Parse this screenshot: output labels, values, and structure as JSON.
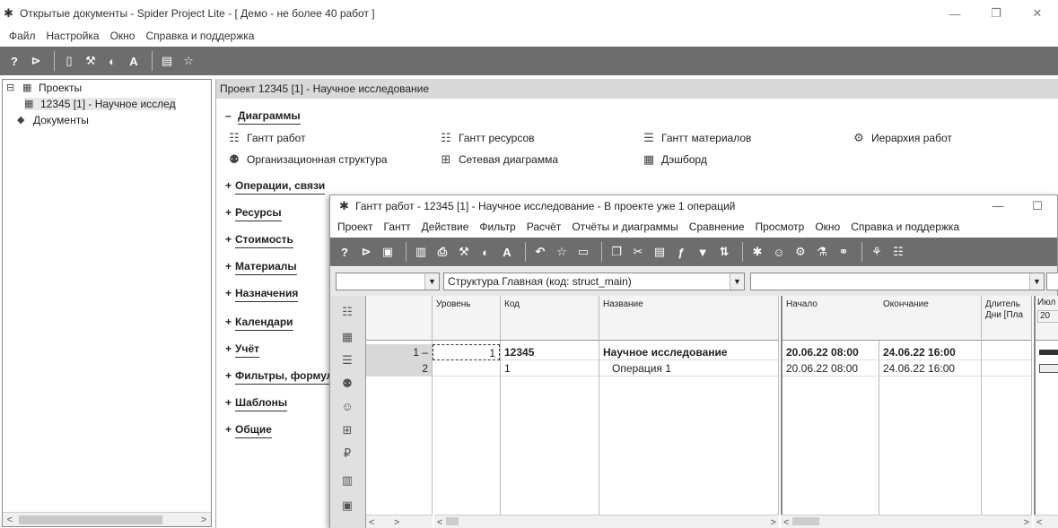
{
  "window": {
    "title": "Открытые документы - Spider Project Lite - [ Демо - не более 40 работ ]",
    "minimize": "—",
    "restore": "❐",
    "close": "✕"
  },
  "menu": [
    "Файл",
    "Настройка",
    "Окно",
    "Справка и поддержка"
  ],
  "tree": {
    "root": "Проекты",
    "project": "12345 [1] - Научное исслед",
    "documents": "Документы"
  },
  "project_panel": {
    "header": "Проект 12345 [1] - Научное исследование",
    "diagrams_section": "Диаграммы",
    "diagrams": {
      "gantt_works": "Гантт работ",
      "gantt_resources": "Гантт ресурсов",
      "gantt_materials": "Гантт материалов",
      "work_hierarchy": "Иерархия работ",
      "org_structure": "Организационная структура",
      "network": "Сетевая диаграмма",
      "dashboard": "Дэшборд"
    },
    "sections": [
      "Операции, связи",
      "Ресурсы",
      "Стоимость",
      "Материалы",
      "Назначения",
      "Календари",
      "Учёт",
      "Фильтры, формулы",
      "Шаблоны",
      "Общие"
    ],
    "collapse_sign": "–",
    "expand_sign": "+"
  },
  "gantt_window": {
    "title": "Гантт работ - 12345 [1] - Научное исследование - В проекте уже 1 операций",
    "minimize": "—",
    "restore": "☐",
    "menu": [
      "Проект",
      "Гантт",
      "Действие",
      "Фильтр",
      "Расчёт",
      "Отчёты и диаграммы",
      "Сравнение",
      "Просмотр",
      "Окно",
      "Справка и поддержка"
    ],
    "structure_combo": "Структура Главная (код: struct_main)",
    "columns": {
      "level": "Уровень",
      "code": "Код",
      "name": "Название",
      "start": "Начало",
      "finish": "Окончание",
      "duration": "Длитель Дни [Пла",
      "month": "Июл",
      "year": "20"
    },
    "rows": [
      {
        "num": "1",
        "mark": "–",
        "level": "1",
        "code": "12345",
        "name": "Научное исследование",
        "start": "20.06.22 08:00",
        "finish": "24.06.22 16:00"
      },
      {
        "num": "2",
        "mark": "",
        "level": "",
        "code": "1",
        "name": "Операция 1",
        "start": "20.06.22 08:00",
        "finish": "24.06.22 16:00"
      }
    ]
  }
}
